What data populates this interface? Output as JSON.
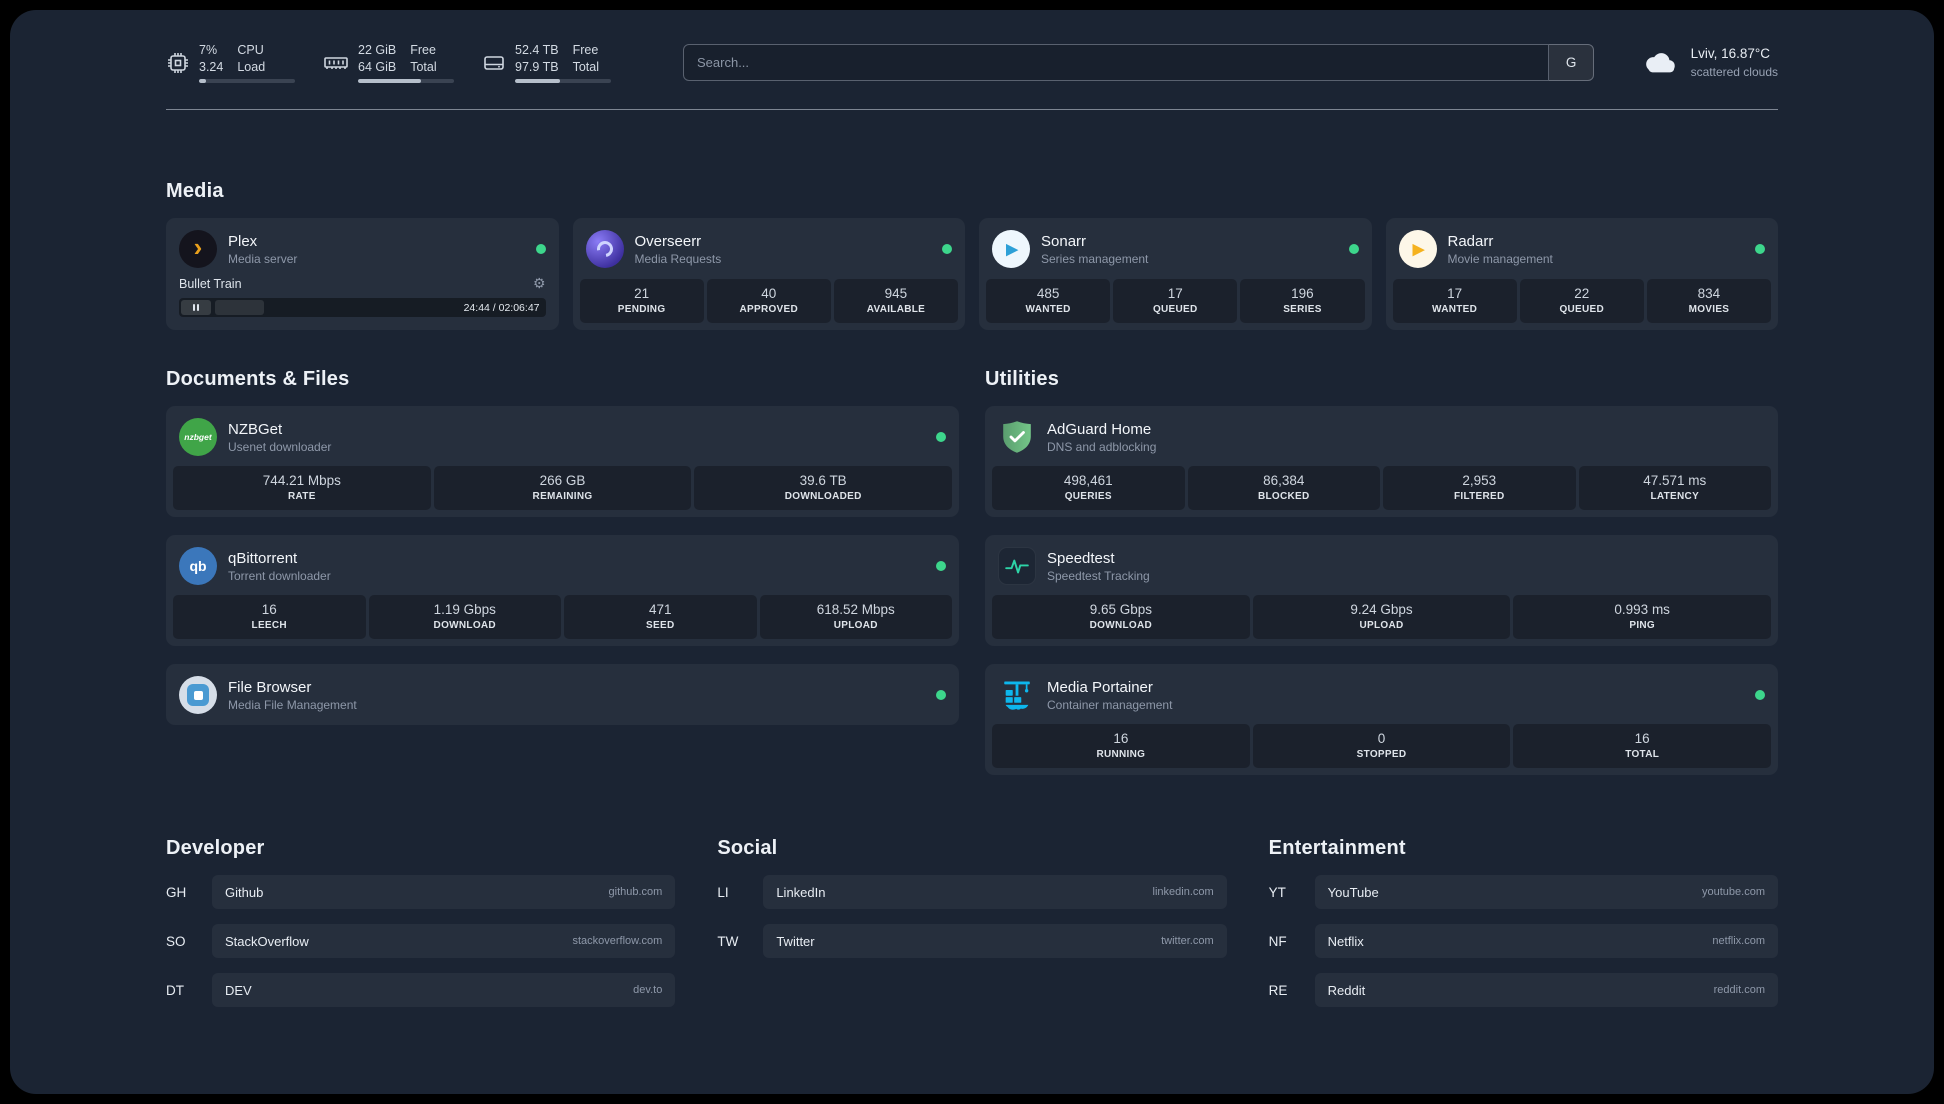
{
  "header": {
    "cpu": {
      "percent": "7%",
      "load_value": "3.24",
      "label1": "CPU",
      "label2": "Load",
      "progress": 7
    },
    "memory": {
      "free_value": "22 GiB",
      "total_value": "64 GiB",
      "label1": "Free",
      "label2": "Total",
      "progress": 66
    },
    "disk": {
      "free_value": "52.4 TB",
      "total_value": "97.9 TB",
      "label1": "Free",
      "label2": "Total",
      "progress": 47
    },
    "search": {
      "placeholder": "Search...",
      "provider_button": "G"
    },
    "weather": {
      "location": "Lviv, 16.87°C",
      "condition": "scattered clouds"
    }
  },
  "icons": {
    "plex_glyph": "›",
    "sonarr_glyph": "▶",
    "radarr_glyph": "▶",
    "nzbget_text": "nzbget",
    "qb_text": "qb",
    "gear": "⚙"
  },
  "colors": {
    "panel_bg": "#1b2433",
    "status_green": "#3dd68c",
    "plex_amber": "#e9a01c",
    "adguard_green": "#67b579",
    "portainer_blue": "#0db7ed",
    "speedtest_green": "#2dd4a7"
  },
  "sections": {
    "media": {
      "title": "Media",
      "cards": [
        {
          "name": "Plex",
          "desc": "Media server",
          "status": true,
          "player": {
            "track": "Bullet Train",
            "time": "24:44 / 02:06:47",
            "progress": 20
          }
        },
        {
          "name": "Overseerr",
          "desc": "Media Requests",
          "status": true,
          "stats": [
            {
              "value": "21",
              "label": "PENDING"
            },
            {
              "value": "40",
              "label": "APPROVED"
            },
            {
              "value": "945",
              "label": "AVAILABLE"
            }
          ]
        },
        {
          "name": "Sonarr",
          "desc": "Series management",
          "status": true,
          "stats": [
            {
              "value": "485",
              "label": "WANTED"
            },
            {
              "value": "17",
              "label": "QUEUED"
            },
            {
              "value": "196",
              "label": "SERIES"
            }
          ]
        },
        {
          "name": "Radarr",
          "desc": "Movie management",
          "status": true,
          "stats": [
            {
              "value": "17",
              "label": "WANTED"
            },
            {
              "value": "22",
              "label": "QUEUED"
            },
            {
              "value": "834",
              "label": "MOVIES"
            }
          ]
        }
      ]
    },
    "documents": {
      "title": "Documents & Files",
      "cards": [
        {
          "name": "NZBGet",
          "desc": "Usenet downloader",
          "status": true,
          "stats": [
            {
              "value": "744.21 Mbps",
              "label": "RATE"
            },
            {
              "value": "266 GB",
              "label": "REMAINING"
            },
            {
              "value": "39.6 TB",
              "label": "DOWNLOADED"
            }
          ]
        },
        {
          "name": "qBittorrent",
          "desc": "Torrent downloader",
          "status": true,
          "stats": [
            {
              "value": "16",
              "label": "LEECH"
            },
            {
              "value": "1.19 Gbps",
              "label": "DOWNLOAD"
            },
            {
              "value": "471",
              "label": "SEED"
            },
            {
              "value": "618.52 Mbps",
              "label": "UPLOAD"
            }
          ]
        },
        {
          "name": "File Browser",
          "desc": "Media File Management",
          "status": true,
          "stats": []
        }
      ]
    },
    "utilities": {
      "title": "Utilities",
      "cards": [
        {
          "name": "AdGuard Home",
          "desc": "DNS and adblocking",
          "status": false,
          "stats": [
            {
              "value": "498,461",
              "label": "QUERIES"
            },
            {
              "value": "86,384",
              "label": "BLOCKED"
            },
            {
              "value": "2,953",
              "label": "FILTERED"
            },
            {
              "value": "47.571 ms",
              "label": "LATENCY"
            }
          ]
        },
        {
          "name": "Speedtest",
          "desc": "Speedtest Tracking",
          "status": false,
          "stats": [
            {
              "value": "9.65 Gbps",
              "label": "DOWNLOAD"
            },
            {
              "value": "9.24 Gbps",
              "label": "UPLOAD"
            },
            {
              "value": "0.993 ms",
              "label": "PING"
            }
          ]
        },
        {
          "name": "Media Portainer",
          "desc": "Container management",
          "status": true,
          "stats": [
            {
              "value": "16",
              "label": "RUNNING"
            },
            {
              "value": "0",
              "label": "STOPPED"
            },
            {
              "value": "16",
              "label": "TOTAL"
            }
          ]
        }
      ]
    },
    "bookmarks": [
      {
        "title": "Developer",
        "items": [
          {
            "abbr": "GH",
            "name": "Github",
            "domain": "github.com"
          },
          {
            "abbr": "SO",
            "name": "StackOverflow",
            "domain": "stackoverflow.com"
          },
          {
            "abbr": "DT",
            "name": "DEV",
            "domain": "dev.to"
          }
        ]
      },
      {
        "title": "Social",
        "items": [
          {
            "abbr": "LI",
            "name": "LinkedIn",
            "domain": "linkedin.com"
          },
          {
            "abbr": "TW",
            "name": "Twitter",
            "domain": "twitter.com"
          }
        ]
      },
      {
        "title": "Entertainment",
        "items": [
          {
            "abbr": "YT",
            "name": "YouTube",
            "domain": "youtube.com"
          },
          {
            "abbr": "NF",
            "name": "Netflix",
            "domain": "netflix.com"
          },
          {
            "abbr": "RE",
            "name": "Reddit",
            "domain": "reddit.com"
          }
        ]
      }
    ]
  }
}
